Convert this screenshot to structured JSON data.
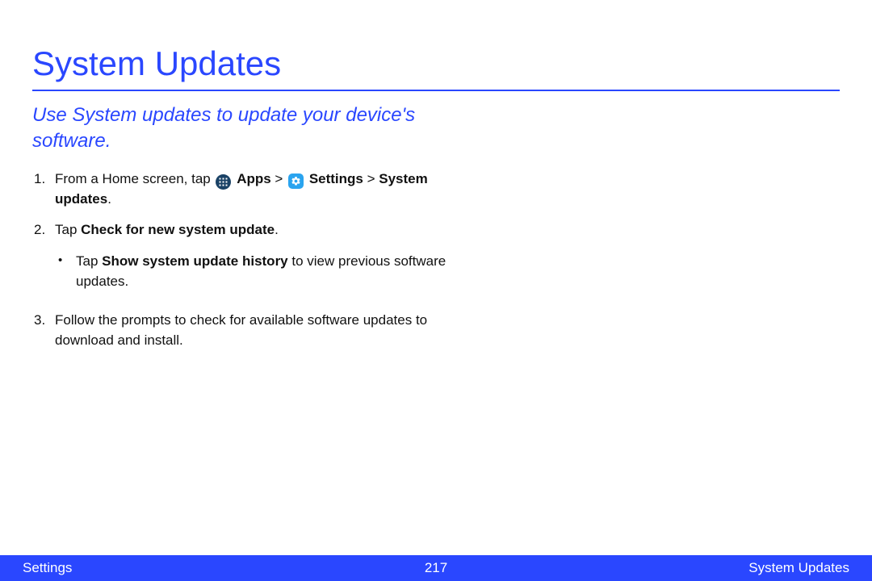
{
  "title": "System Updates",
  "intro": "Use System updates to update your device's software.",
  "steps": {
    "s1": {
      "num": "1.",
      "prefix": "From a Home screen, tap ",
      "apps_label": "Apps",
      "gt1": " > ",
      "settings_label": "Settings",
      "gt2": " > ",
      "system_updates_label": "System updates",
      "period": "."
    },
    "s2": {
      "num": "2.",
      "prefix": "Tap ",
      "bold": "Check for new system update",
      "period": ".",
      "bullet": {
        "mark": "•",
        "prefix": "Tap ",
        "bold": "Show system update history",
        "suffix": " to view previous software updates."
      }
    },
    "s3": {
      "num": "3.",
      "text": "Follow the prompts to check for available software updates to download and install."
    }
  },
  "footer": {
    "left": "Settings",
    "center": "217",
    "right": "System Updates"
  }
}
